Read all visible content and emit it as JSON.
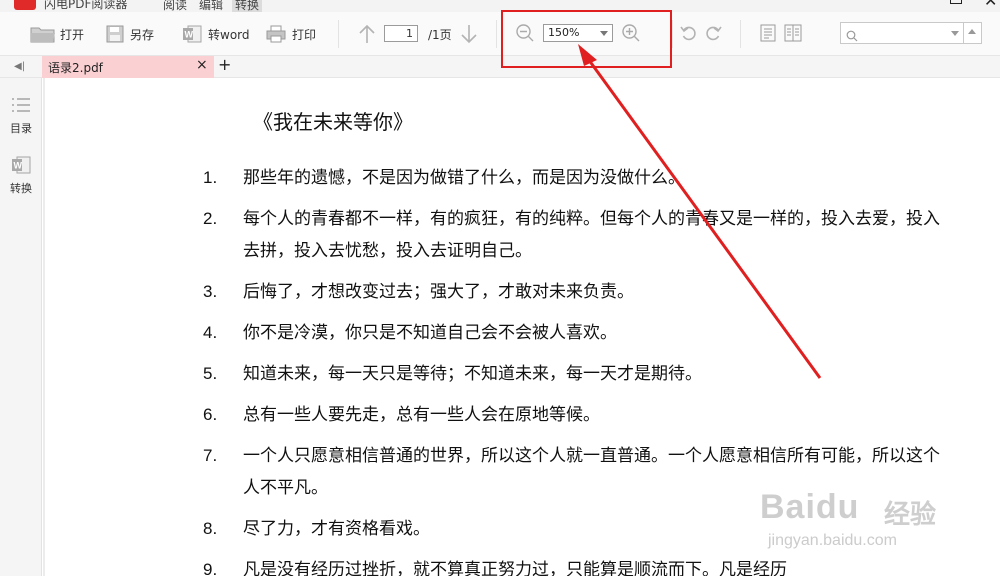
{
  "app": {
    "title": "闪电PDF阅读器",
    "menu_tabs": [
      {
        "label": "阅读",
        "active": false
      },
      {
        "label": "编辑",
        "active": false
      },
      {
        "label": "转换",
        "active": true
      }
    ]
  },
  "toolbar": {
    "open_label": "打开",
    "save_as_label": "另存",
    "to_word_label": "转word",
    "print_label": "打印",
    "current_page": "1",
    "page_total": "/1页",
    "zoom_value": "150%",
    "search_placeholder": ""
  },
  "tabs": {
    "doc_tab_label": "语录2.pdf",
    "close_symbol": "×",
    "new_tab_symbol": "+"
  },
  "sidebar": {
    "items": [
      {
        "label": "目录",
        "icon": "list-icon"
      },
      {
        "label": "转换",
        "icon": "convert-icon"
      }
    ]
  },
  "document": {
    "title": "《我在未来等你》",
    "items": [
      {
        "num": "1.",
        "text": "那些年的遗憾，不是因为做错了什么，而是因为没做什么。"
      },
      {
        "num": "2.",
        "text": "每个人的青春都不一样，有的疯狂，有的纯粹。但每个人的青春又是一样的，投入去爱，投入去拼，投入去忧愁，投入去证明自己。"
      },
      {
        "num": "3.",
        "text": "后悔了，才想改变过去；强大了，才敢对未来负责。"
      },
      {
        "num": "4.",
        "text": "你不是冷漠，你只是不知道自己会不会被人喜欢。"
      },
      {
        "num": "5.",
        "text": "知道未来，每一天只是等待；不知道未来，每一天才是期待。"
      },
      {
        "num": "6.",
        "text": "总有一些人要先走，总有一些人会在原地等候。"
      },
      {
        "num": "7.",
        "text": "一个人只愿意相信普通的世界，所以这个人就一直普通。一个人愿意相信所有可能，所以这个人不平凡。"
      },
      {
        "num": "8.",
        "text": "尽了力，才有资格看戏。"
      },
      {
        "num": "9.",
        "text": "凡是没有经历过挫折，就不算真正努力过，只能算是顺流而下。凡是经历"
      }
    ]
  },
  "watermark": {
    "brand": "Baidu",
    "cn": "经验",
    "url": "jingyan.baidu.com"
  },
  "colors": {
    "accent_red": "#e02020",
    "tab_pink": "#fbd0d3",
    "brand_red": "#e02a2a"
  }
}
